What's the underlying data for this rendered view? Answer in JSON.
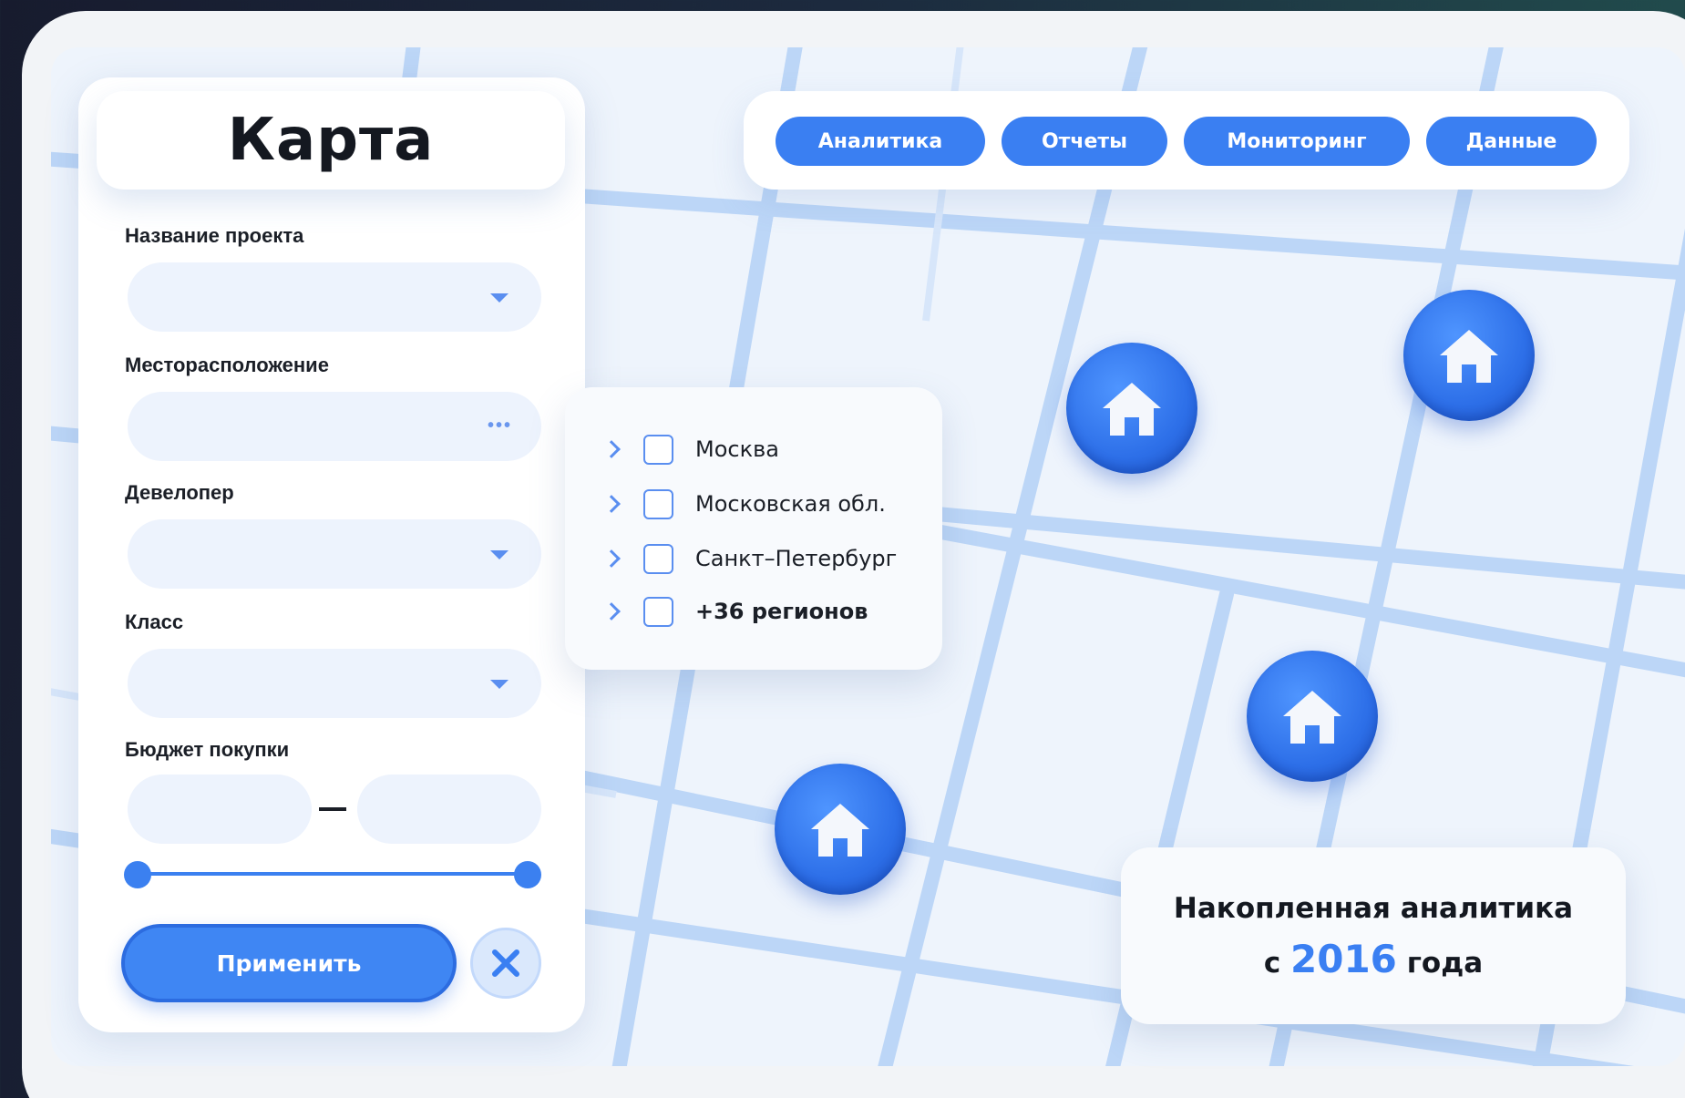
{
  "panel": {
    "title": "Карта",
    "fields": [
      {
        "label": "Название проекта",
        "value": "",
        "control": "dropdown"
      },
      {
        "label": "Месторасположение",
        "value": "",
        "control": "more"
      },
      {
        "label": "Девелопер",
        "value": "",
        "control": "dropdown"
      },
      {
        "label": "Класс",
        "value": "",
        "control": "dropdown"
      }
    ],
    "budget": {
      "label": "Бюджет покупки",
      "min_value": "",
      "max_value": "",
      "separator": "—"
    },
    "apply_label": "Применить",
    "more_glyph": "•••"
  },
  "regions": [
    {
      "label": "Москва",
      "checked": false,
      "bold": false
    },
    {
      "label": "Московская обл.",
      "checked": false,
      "bold": false
    },
    {
      "label": "Санкт–Петербург",
      "checked": false,
      "bold": false
    },
    {
      "label": "+36 регионов",
      "checked": false,
      "bold": true
    }
  ],
  "nav": {
    "tabs": [
      "Аналитика",
      "Отчеты",
      "Мониторинг",
      "Данные"
    ]
  },
  "stats": {
    "line1": "Накопленная аналитика",
    "prefix": "с",
    "year": "2016",
    "suffix": "года"
  },
  "colors": {
    "accent": "#3a7ff2",
    "field_bg": "#edf3fd",
    "map_road": "#bcd6f7"
  },
  "icons": [
    "house-icon",
    "chevron-right-icon",
    "chevron-down-icon",
    "close-icon",
    "more-dots-icon"
  ]
}
